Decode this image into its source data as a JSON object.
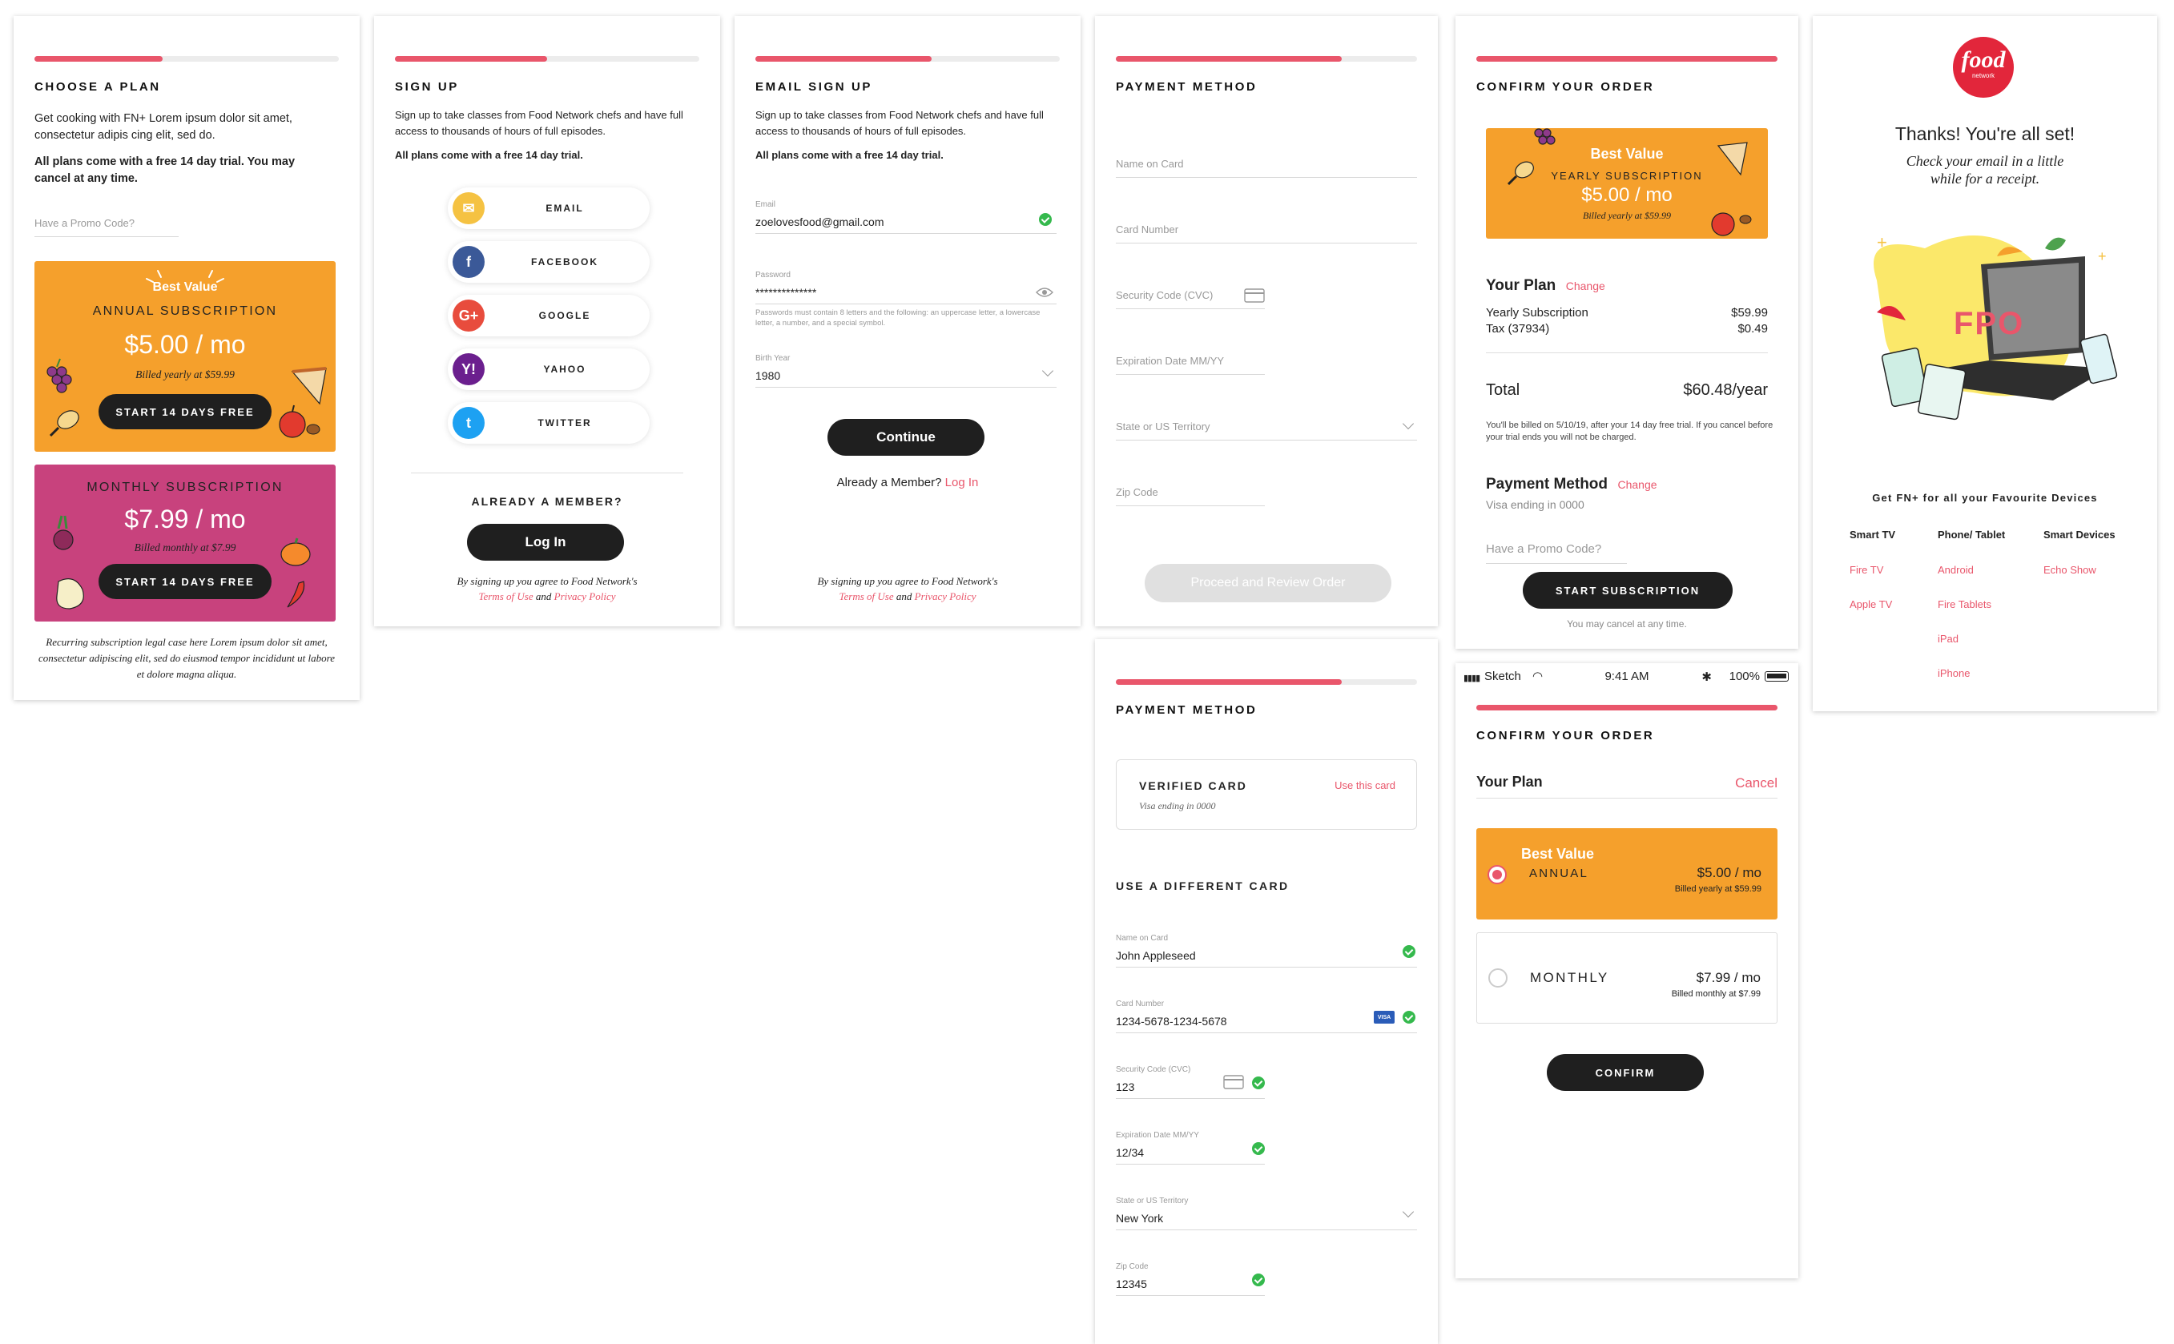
{
  "choose_plan": {
    "title": "CHOOSE A PLAN",
    "intro": "Get cooking with FN+ Lorem ipsum dolor sit amet, consectetur adipis cing elit, sed do.",
    "trial_note": "All plans come with a free 14 day trial. You may cancel at any time.",
    "promo_placeholder": "Have a Promo Code?",
    "annual": {
      "badge": "Best Value",
      "name": "ANNUAL SUBSCRIPTION",
      "price": "$5.00 / mo",
      "billed": "Billed yearly at $59.99",
      "cta": "START 14 DAYS FREE"
    },
    "monthly": {
      "name": "MONTHLY SUBSCRIPTION",
      "price": "$7.99 / mo",
      "billed": "Billed monthly at $7.99",
      "cta": "START 14 DAYS FREE"
    },
    "legal": "Recurring subscription legal case here Lorem ipsum dolor sit amet, consectetur adipiscing elit, sed do eiusmod tempor incididunt ut labore et dolore magna aliqua."
  },
  "sign_up": {
    "title": "SIGN UP",
    "intro": "Sign up to take classes from Food Network chefs and have full access to thousands of hours of full episodes.",
    "trial_note": "All plans come with a free 14 day trial.",
    "options": [
      {
        "label": "EMAIL",
        "icon": "email-icon",
        "color": "#f5c242",
        "glyph": "✉"
      },
      {
        "label": "FACEBOOK",
        "icon": "facebook-icon",
        "color": "#3b5998",
        "glyph": "f"
      },
      {
        "label": "GOOGLE",
        "icon": "google-icon",
        "color": "#e84c3d",
        "glyph": "G+"
      },
      {
        "label": "YAHOO",
        "icon": "yahoo-icon",
        "color": "#6b1f8e",
        "glyph": "Y!"
      },
      {
        "label": "TWITTER",
        "icon": "twitter-icon",
        "color": "#1da1f2",
        "glyph": "t"
      }
    ],
    "already_member": "ALREADY A MEMBER?",
    "login_button": "Log In",
    "terms_prefix": "By signing up you agree to Food Network's",
    "terms_link": "Terms of Use",
    "terms_and": "and",
    "privacy_link": "Privacy Policy"
  },
  "email_sign_up": {
    "title": "EMAIL SIGN UP",
    "intro": "Sign up to take classes from Food Network chefs and have full access to thousands of hours of full episodes.",
    "trial_note": "All plans come with a free 14 day trial.",
    "email_label": "Email",
    "email_value": "zoelovesfood@gmail.com",
    "password_label": "Password",
    "password_value": "**************",
    "password_hint": "Passwords must contain 8 letters and the following: an uppercase letter, a lowercase letter, a number, and a special symbol.",
    "birth_label": "Birth Year",
    "birth_value": "1980",
    "continue_button": "Continue",
    "already_member": "Already a Member?",
    "login_link": "Log In",
    "terms_prefix": "By signing up you agree to Food Network's",
    "terms_link": "Terms of Use",
    "terms_and": "and",
    "privacy_link": "Privacy Policy"
  },
  "payment_method": {
    "title": "PAYMENT METHOD",
    "name_placeholder": "Name on Card",
    "card_placeholder": "Card Number",
    "cvc_placeholder": "Security Code (CVC)",
    "exp_placeholder": "Expiration Date MM/YY",
    "state_placeholder": "State or US Territory",
    "zip_placeholder": "Zip Code",
    "proceed_button": "Proceed and Review Order"
  },
  "payment_method_2": {
    "title": "PAYMENT METHOD",
    "verified_title": "VERIFIED CARD",
    "use_card": "Use this card",
    "verified_sub": "Visa ending in 0000",
    "different_title": "USE A DIFFERENT CARD",
    "name_label": "Name on Card",
    "name_value": "John Appleseed",
    "card_label": "Card Number",
    "card_value": "1234-5678-1234-5678",
    "card_brand": "VISA",
    "cvc_label": "Security Code (CVC)",
    "cvc_value": "123",
    "exp_label": "Expiration Date MM/YY",
    "exp_value": "12/34",
    "state_label": "State or US Territory",
    "state_value": "New York",
    "zip_label": "Zip Code",
    "zip_value": "12345"
  },
  "confirm_order": {
    "title": "CONFIRM YOUR ORDER",
    "badge": "Best Value",
    "plan_name": "YEARLY SUBSCRIPTION",
    "price": "$5.00 / mo",
    "billed": "Billed yearly at $59.99",
    "your_plan": "Your Plan",
    "change": "Change",
    "line1_label": "Yearly Subscription",
    "line1_value": "$59.99",
    "line2_label": "Tax (37934)",
    "line2_value": "$0.49",
    "total_label": "Total",
    "total_value": "$60.48/year",
    "billing_note": "You'll be billed on 5/10/19, after your 14 day free trial. If you cancel before your trial ends you will not be charged.",
    "payment_method": "Payment Method",
    "payment_change": "Change",
    "visa_note": "Visa ending in 0000",
    "promo_placeholder": "Have a Promo Code?",
    "start_button": "START SUBSCRIPTION",
    "cancel_note": "You may cancel at any time."
  },
  "confirm_order_2": {
    "status_carrier": "Sketch",
    "status_time": "9:41 AM",
    "status_battery": "100%",
    "title": "CONFIRM YOUR ORDER",
    "your_plan": "Your Plan",
    "cancel": "Cancel",
    "annual_badge": "Best Value",
    "annual_name": "ANNUAL",
    "annual_price": "$5.00 / mo",
    "annual_billed": "Billed yearly at $59.99",
    "monthly_name": "MONTHLY",
    "monthly_price": "$7.99 / mo",
    "monthly_billed": "Billed monthly at $7.99",
    "confirm_button": "CONFIRM"
  },
  "thanks": {
    "logo": "food",
    "logo_sub": "network",
    "heading": "Thanks! You're all set!",
    "sub": "Check your email in a little while for a receipt.",
    "fpo": "FPO",
    "devices_title": "Get FN+ for all your Favourite Devices",
    "columns": [
      {
        "title": "Smart TV",
        "items": [
          "Fire TV",
          "Apple TV"
        ]
      },
      {
        "title": "Phone/ Tablet",
        "items": [
          "Android",
          "Fire Tablets",
          "iPad",
          "iPhone"
        ]
      },
      {
        "title": "Smart Devices",
        "items": [
          "Echo Show"
        ]
      }
    ]
  },
  "colors": {
    "accent": "#e9566b",
    "orange": "#f5a02c",
    "magenta": "#c8427d",
    "dark": "#1f1f1f",
    "green": "#35b94d"
  }
}
